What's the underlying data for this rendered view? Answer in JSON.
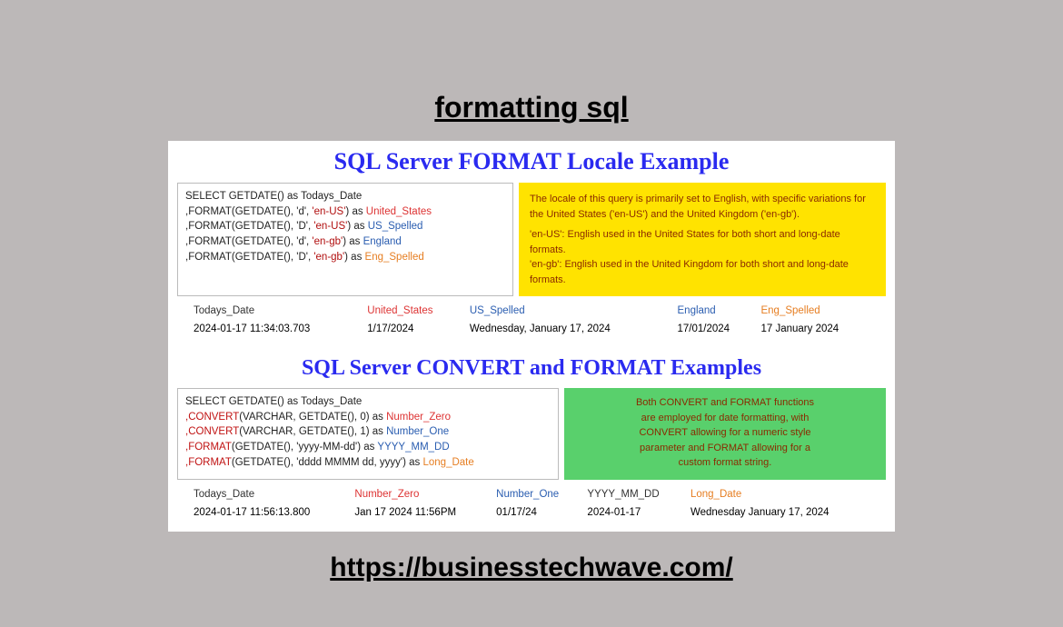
{
  "caption_top": "formatting sql",
  "caption_bottom": "https://businesstechwave.com/",
  "section1": {
    "title": "SQL Server FORMAT Locale Example",
    "code": {
      "line1_a": "SELECT  GETDATE() as Todays_Date",
      "line2_a": ",FORMAT",
      "line2_b": "(GETDATE(), 'd', ",
      "line2_c": "'en-US'",
      "line2_d": ") as ",
      "line2_e": "United_States",
      "line3_a": ",FORMAT",
      "line3_b": "(GETDATE(), 'D', ",
      "line3_c": "'en-US'",
      "line3_d": ") as ",
      "line3_e": "US_Spelled",
      "line4_a": ",FORMAT",
      "line4_b": "(GETDATE(), 'd', ",
      "line4_c": "'en-gb'",
      "line4_d": ") as ",
      "line4_e": "England",
      "line5_a": ",FORMAT",
      "line5_b": "(GETDATE(), 'D', ",
      "line5_c": "'en-gb'",
      "line5_d": ") as ",
      "line5_e": "Eng_Spelled"
    },
    "note": {
      "p1": "The locale of this query is primarily set to English, with specific variations for the United States ('en-US') and the United Kingdom ('en-gb').",
      "p2": "'en-US': English used in the United States for both short and long-date formats.",
      "p3": "'en-gb': English used in the United Kingdom for both short and long-date formats."
    },
    "results": {
      "h1": "Todays_Date",
      "h2": "United_States",
      "h3": "US_Spelled",
      "h4": "England",
      "h5": "Eng_Spelled",
      "c1": "2024-01-17 11:34:03.703",
      "c2": "1/17/2024",
      "c3": "Wednesday, January 17, 2024",
      "c4": "17/01/2024",
      "c5": "17 January 2024"
    }
  },
  "section2": {
    "title": "SQL Server CONVERT and FORMAT Examples",
    "code": {
      "line1_a": "SELECT GETDATE() as Todays_Date",
      "line2_a": ",CONVERT",
      "line2_b": "(VARCHAR, GETDATE(), 0) as ",
      "line2_c": "Number_Zero",
      "line3_a": ",CONVERT",
      "line3_b": "(VARCHAR, GETDATE(), 1) as ",
      "line3_c": "Number_One",
      "line4_a": ",FORMAT",
      "line4_b": "(GETDATE(), 'yyyy-MM-dd') as ",
      "line4_c": "YYYY_MM_DD",
      "line5_a": ",FORMAT",
      "line5_b": "(GETDATE(), 'dddd MMMM dd, yyyy') as ",
      "line5_c": "Long_Date"
    },
    "note": {
      "l1": "Both CONVERT and FORMAT functions",
      "l2": "are employed for date formatting, with",
      "l3": "CONVERT allowing for a numeric style",
      "l4": "parameter and FORMAT allowing for a",
      "l5": "custom format string."
    },
    "results": {
      "h1": "Todays_Date",
      "h2": "Number_Zero",
      "h3": "Number_One",
      "h4": "YYYY_MM_DD",
      "h5": "Long_Date",
      "c1": "2024-01-17 11:56:13.800",
      "c2": "Jan 17 2024 11:56PM",
      "c3": "01/17/24",
      "c4": "2024-01-17",
      "c5": "Wednesday January 17, 2024"
    }
  }
}
